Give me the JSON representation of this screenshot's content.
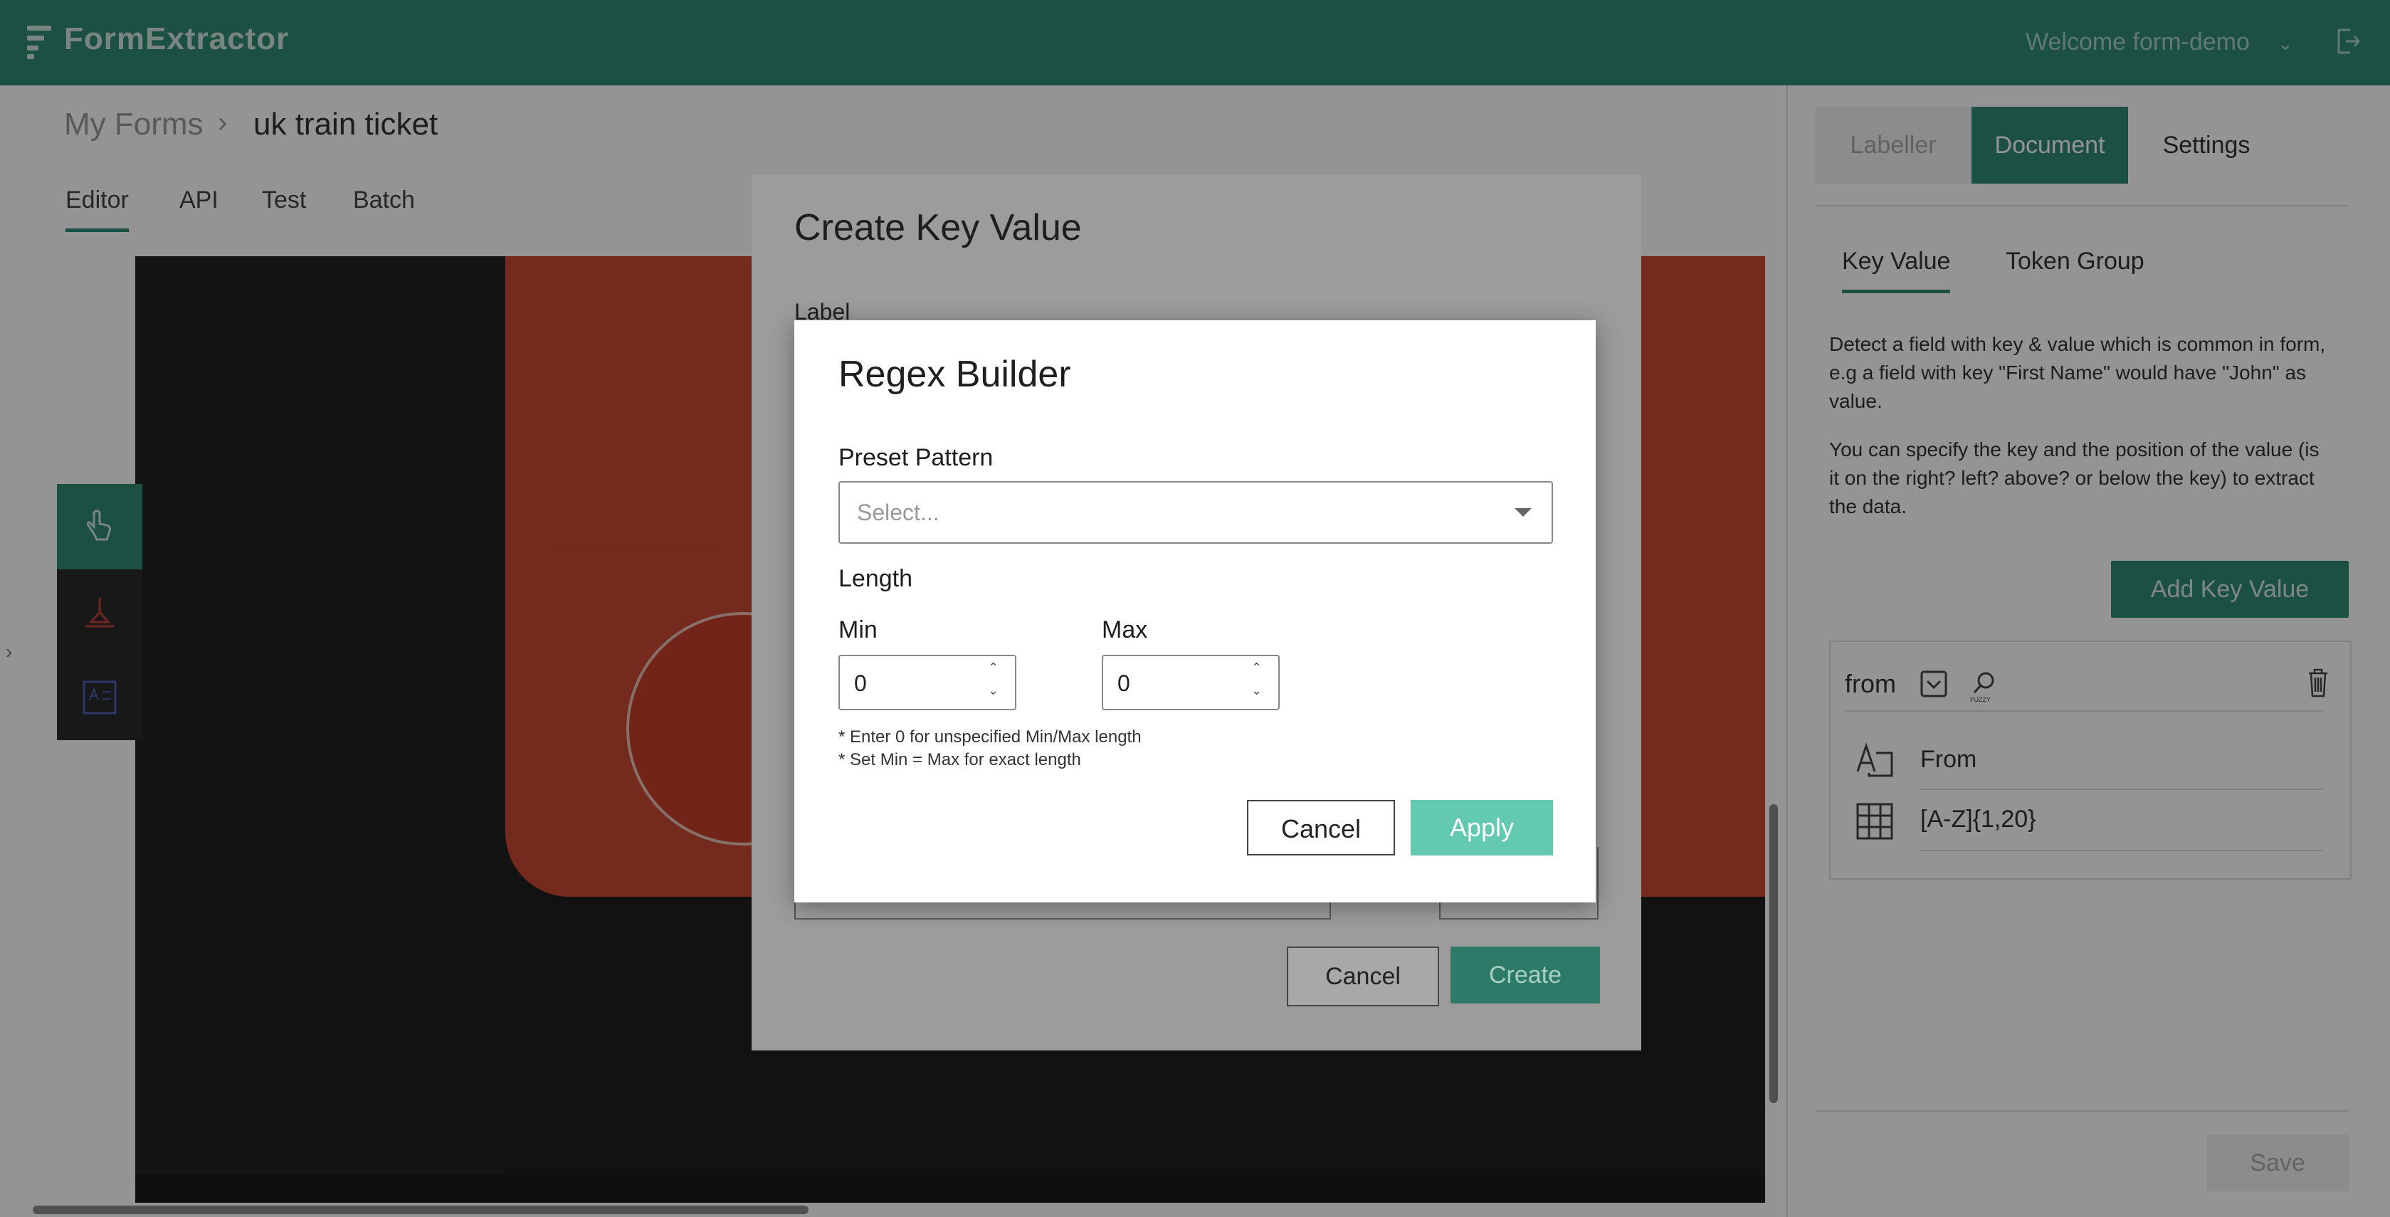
{
  "app": {
    "name": "FormExtractor",
    "welcome": "Welcome form-demo"
  },
  "breadcrumb": {
    "root": "My Forms",
    "separator": "›",
    "current": "uk train ticket"
  },
  "editor_tabs": [
    "Editor",
    "API",
    "Test",
    "Batch"
  ],
  "right_panel": {
    "tabs": [
      "Labeller",
      "Document",
      "Settings"
    ],
    "subtabs": [
      "Key Value",
      "Token Group"
    ],
    "description": [
      "Detect a field with key & value which is common in form, e.g a field with key \"First Name\" would have \"John\" as value.",
      "You can specify the key and the position of the value (is it on the right? left? above? or below the key) to extract the data."
    ],
    "add_button": "Add Key Value",
    "key_value_card": {
      "name": "from",
      "fuzzy_label": "FUZZY",
      "key_text": "From",
      "value_regex": "[A-Z]{1,20}"
    },
    "save_button": "Save"
  },
  "create_dialog": {
    "title": "Create Key Value",
    "label": "Label",
    "cancel": "Cancel",
    "create": "Create"
  },
  "regex_builder": {
    "title": "Regex Builder",
    "preset_label": "Preset Pattern",
    "preset_placeholder": "Select...",
    "length_label": "Length",
    "min_label": "Min",
    "min_value": "0",
    "max_label": "Max",
    "max_value": "0",
    "hint1": "* Enter 0 for unspecified Min/Max length",
    "hint2": "* Set Min = Max for exact length",
    "cancel": "Cancel",
    "apply": "Apply"
  },
  "colors": {
    "brand": "#2f8a72",
    "apply": "#63c9b0"
  },
  "icons": [
    "logo-icon",
    "chevron-down-icon",
    "logout-icon",
    "pan-tool-icon",
    "key-tool-icon",
    "text-tool-icon",
    "dropdown-icon",
    "fuzzy-search-icon",
    "trash-icon",
    "text-key-icon",
    "regex-value-icon"
  ]
}
